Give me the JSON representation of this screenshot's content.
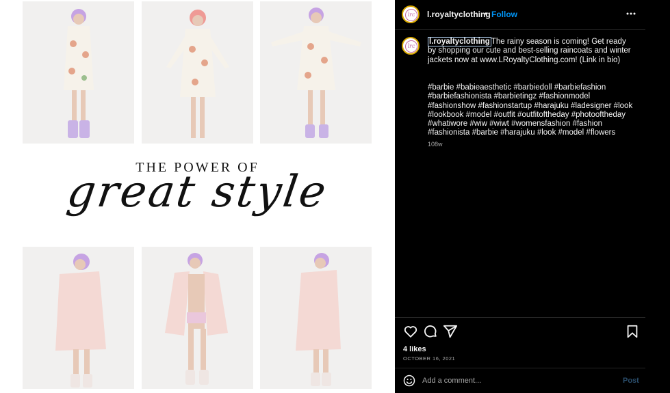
{
  "post_image": {
    "headline_top": "THE POWER OF",
    "headline_script": "great style"
  },
  "header": {
    "username": "l.royaltyclothing",
    "separator": "•",
    "follow_label": "Follow",
    "avatar_monogram": "lrc",
    "more_icon": "more-horizontal-icon"
  },
  "caption": {
    "username": "l.royaltyclothing",
    "text": "The rainy season is coming! Get ready by shopping our cute and best-selling raincoats and winter jackets now at www.LRoyaltyClothing.com! (Link in bio)",
    "hashtags": "#barbie #babieaesthetic #barbiedoll #barbiefashion #barbiefashionista #barbietingz #fashionmodel #fashionshow #fashionstartup #harajuku #ladesigner #look #lookbook #model #outfit #outfitoftheday #photooftheday #whatiwore #wiw #wiwt #womensfashion #fashion #fashionista #barbie #harajuku #look #model #flowers",
    "time_ago": "108w"
  },
  "actions": {
    "icons": [
      "heart-icon",
      "comment-icon",
      "share-icon",
      "bookmark-icon"
    ]
  },
  "stats": {
    "likes": "4 likes",
    "date": "OCTOBER 16, 2021"
  },
  "comment": {
    "placeholder": "Add a comment...",
    "post_label": "Post",
    "emoji_icon": "emoji-icon"
  },
  "colors": {
    "panel_bg": "#000000",
    "follow_blue": "#0095f6",
    "post_disabled": "#2a4d6b",
    "avatar_ring": "#d8a700",
    "monogram_pink": "#c26aa8"
  }
}
